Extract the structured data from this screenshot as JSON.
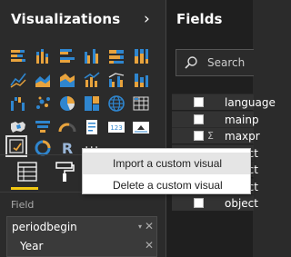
{
  "visualizations": {
    "title": "Visualizations",
    "collapse_icon": "chevron-right-icon",
    "icons": [
      "stacked-bar-chart-icon",
      "stacked-column-chart-icon",
      "clustered-bar-chart-icon",
      "clustered-column-chart-icon",
      "100-stacked-bar-chart-icon",
      "100-stacked-column-chart-icon",
      "line-chart-icon",
      "area-chart-icon",
      "stacked-area-chart-icon",
      "line-and-column-chart-icon",
      "line-and-clustered-column-chart-icon",
      "ribbon-chart-icon",
      "waterfall-chart-icon",
      "scatter-chart-icon",
      "pie-chart-icon",
      "donut-chart-icon",
      "treemap-icon",
      "map-icon",
      "filled-map-icon",
      "funnel-icon",
      "gauge-icon",
      "multi-row-card-icon",
      "card-icon",
      "kpi-icon",
      "slicer-icon",
      "table-icon",
      "matrix-icon",
      "r-script-visual-icon",
      "more-options-icon"
    ],
    "more_label": "...",
    "r_label": "R",
    "card_label": "123",
    "tabs": [
      "fields-tab-icon",
      "format-paint-roller-icon"
    ],
    "field_section_label": "Field",
    "well": {
      "field_name": "periodbegin",
      "sub_field": "Year",
      "dropdown_icon": "▾",
      "remove_icon": "✕"
    }
  },
  "fields": {
    "title": "Fields",
    "search_placeholder": "Search",
    "items": [
      {
        "name": "language",
        "sigma": false
      },
      {
        "name": "mainp",
        "sigma": false
      },
      {
        "name": "maxpr",
        "sigma": true
      },
      {
        "name": "object",
        "sigma": false
      },
      {
        "name": "object",
        "sigma": false
      },
      {
        "name": "object",
        "sigma": false
      },
      {
        "name": "object",
        "sigma": false
      }
    ],
    "sigma_symbol": "Σ"
  },
  "context_menu": {
    "items": [
      {
        "label": "Import a custom visual",
        "hover": true
      },
      {
        "label": "Delete a custom visual",
        "hover": false
      }
    ]
  },
  "colors": {
    "pane_bg": "#2b2b2b",
    "fields_bg": "#1f1f1f",
    "accent_yellow": "#f2c811",
    "chart_blue": "#2f86cf",
    "chart_orange": "#e8a33d"
  }
}
